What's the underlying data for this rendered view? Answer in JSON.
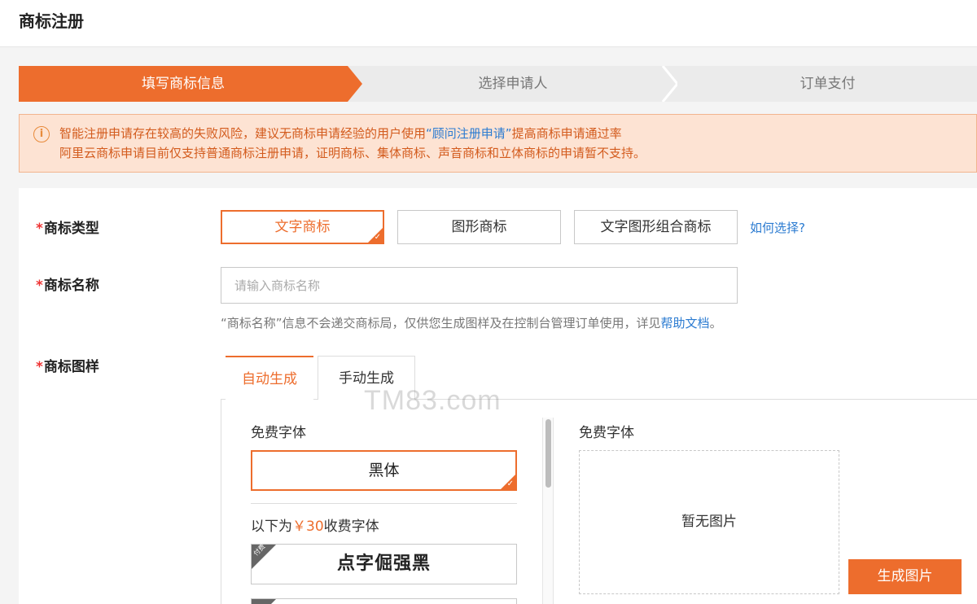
{
  "header": {
    "title": "商标注册"
  },
  "steps": [
    {
      "label": "填写商标信息",
      "state": "active"
    },
    {
      "label": "选择申请人",
      "state": "pending"
    },
    {
      "label": "订单支付",
      "state": "pending"
    }
  ],
  "notice": {
    "line1_prefix": "智能注册申请存在较高的失败风险，建议无商标申请经验的用户使用",
    "line1_link": "“顾问注册申请”",
    "line1_suffix": "提高商标申请通过率",
    "line2": "阿里云商标申请目前仅支持普通商标注册申请，证明商标、集体商标、声音商标和立体商标的申请暂不支持。"
  },
  "form": {
    "type": {
      "required_mark": "*",
      "label": "商标类型",
      "options": [
        "文字商标",
        "图形商标",
        "文字图形组合商标"
      ],
      "selected": "文字商标",
      "help_link": "如何选择?"
    },
    "name": {
      "required_mark": "*",
      "label": "商标名称",
      "value": "",
      "placeholder": "请输入商标名称",
      "hint_prefix": "“商标名称”信息不会递交商标局，仅供您生成图样及在控制台管理订单使用，详见",
      "hint_link": "帮助文档",
      "hint_suffix": "。"
    },
    "sample": {
      "required_mark": "*",
      "label": "商标图样",
      "tabs": [
        "自动生成",
        "手动生成"
      ],
      "active_tab": "自动生成",
      "free_label": "免费字体",
      "free_fonts": [
        "黑体"
      ],
      "paid_label_prefix": "以下为",
      "paid_price": "￥30",
      "paid_label_suffix": "收费字体",
      "paid_fonts": [
        "点字倔强黑"
      ],
      "paid_badge": "付费",
      "preview_label": "免费字体",
      "preview_empty": "暂无图片",
      "generate_button": "生成图片"
    }
  },
  "watermark": "TM83.com",
  "colors": {
    "accent": "#ed6d2d",
    "link": "#2b7bd1",
    "notice_bg": "#fde3d3",
    "notice_text": "#d35b1d"
  }
}
